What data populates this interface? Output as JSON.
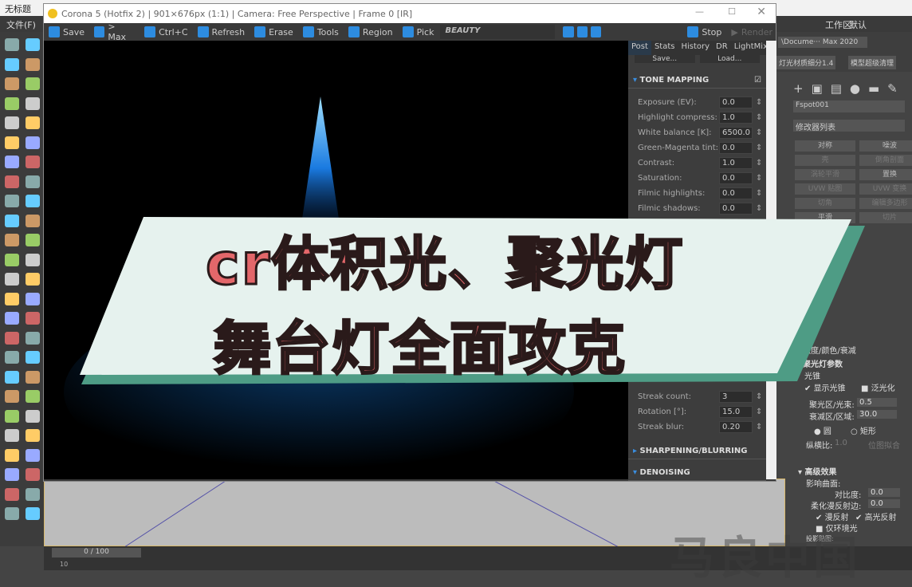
{
  "max": {
    "title": "无标题",
    "menu": "文件(F)",
    "workspace_label": "工作区:",
    "workspace_value": "默认",
    "path": "\\Docume··· Max 2020",
    "plugins": [
      "灯光材质细分1.4",
      "模型超级清理"
    ]
  },
  "corona": {
    "title": "Corona 5 (Hotfix 2) | 901×676px (1:1) | Camera: Free Perspective | Frame 0 [IR]",
    "toolbar": [
      "Save",
      "> Max",
      "Ctrl+C",
      "Refresh",
      "Erase",
      "Tools",
      "Region",
      "Pick"
    ],
    "channel": "BEAUTY",
    "stop": "Stop",
    "render": "Render",
    "tabs": [
      "Post",
      "Stats",
      "History",
      "DR",
      "LightMix"
    ],
    "save_btn": "Save...",
    "load_btn": "Load...",
    "tone_mapping": {
      "title": "TONE MAPPING",
      "checked": true,
      "rows": [
        {
          "label": "Exposure (EV):",
          "value": "0.0"
        },
        {
          "label": "Highlight compress:",
          "value": "1.0"
        },
        {
          "label": "White balance [K]:",
          "value": "6500.0"
        },
        {
          "label": "Green-Magenta tint:",
          "value": "0.0"
        },
        {
          "label": "Contrast:",
          "value": "1.0"
        },
        {
          "label": "Saturation:",
          "value": "0.0"
        },
        {
          "label": "Filmic highlights:",
          "value": "0.0"
        },
        {
          "label": "Filmic shadows:",
          "value": "0.0"
        }
      ]
    },
    "bloom_rows": [
      {
        "label": "Streak count:",
        "value": "3"
      },
      {
        "label": "Rotation [°]:",
        "value": "15.0"
      },
      {
        "label": "Streak blur:",
        "value": "0.20"
      }
    ],
    "sharpening": "SHARPENING/BLURRING",
    "denoising": "DENOISING"
  },
  "command_panel": {
    "object_name": "Fspot001",
    "modifier_list": "修改器列表",
    "buttons": [
      {
        "label": "对称",
        "enabled": true
      },
      {
        "label": "噪波",
        "enabled": true
      },
      {
        "label": "壳",
        "enabled": false
      },
      {
        "label": "倒角剖面",
        "enabled": false
      },
      {
        "label": "涡轮平滑",
        "enabled": false
      },
      {
        "label": "置换",
        "enabled": true
      },
      {
        "label": "UVW 贴图",
        "enabled": false
      },
      {
        "label": "UVW 变换",
        "enabled": false
      },
      {
        "label": "切角",
        "enabled": false
      },
      {
        "label": "编辑多边形",
        "enabled": false
      },
      {
        "label": "平滑",
        "enabled": true
      },
      {
        "label": "切片",
        "enabled": false
      }
    ],
    "intensity_section": "强度/颜色/衰减",
    "spot_params": "聚光灯参数",
    "cone": "光锥",
    "show_cone": "显示光锥",
    "overshoot": "泛光化",
    "hotspot_label": "聚光区/光束:",
    "hotspot": "0.5",
    "falloff_label": "衰减区/区域:",
    "falloff": "30.0",
    "circle": "圆",
    "rectangle": "矩形",
    "aspect_label": "纵横比:",
    "aspect": "1.0",
    "bitmap_fit": "位图拟合",
    "advanced": "高级效果",
    "affect_surfaces": "影响曲面:",
    "contrast_label": "对比度:",
    "contrast": "0.0",
    "soften_label": "柔化漫反射边:",
    "soften": "0.0",
    "diffuse": "漫反射",
    "specular": "高光反射",
    "ambient_only": "仅环境光",
    "projector": "投影贴图:"
  },
  "timeline": {
    "frame": "0 / 100",
    "tick": "10"
  },
  "overlay": {
    "line1": "cr体积光、聚光灯",
    "line2": "舞台灯全面攻克",
    "bg": "#e6f2ee",
    "shadow": "#4e9c85",
    "text_color": "#e3676a"
  },
  "watermark": "马良中国"
}
